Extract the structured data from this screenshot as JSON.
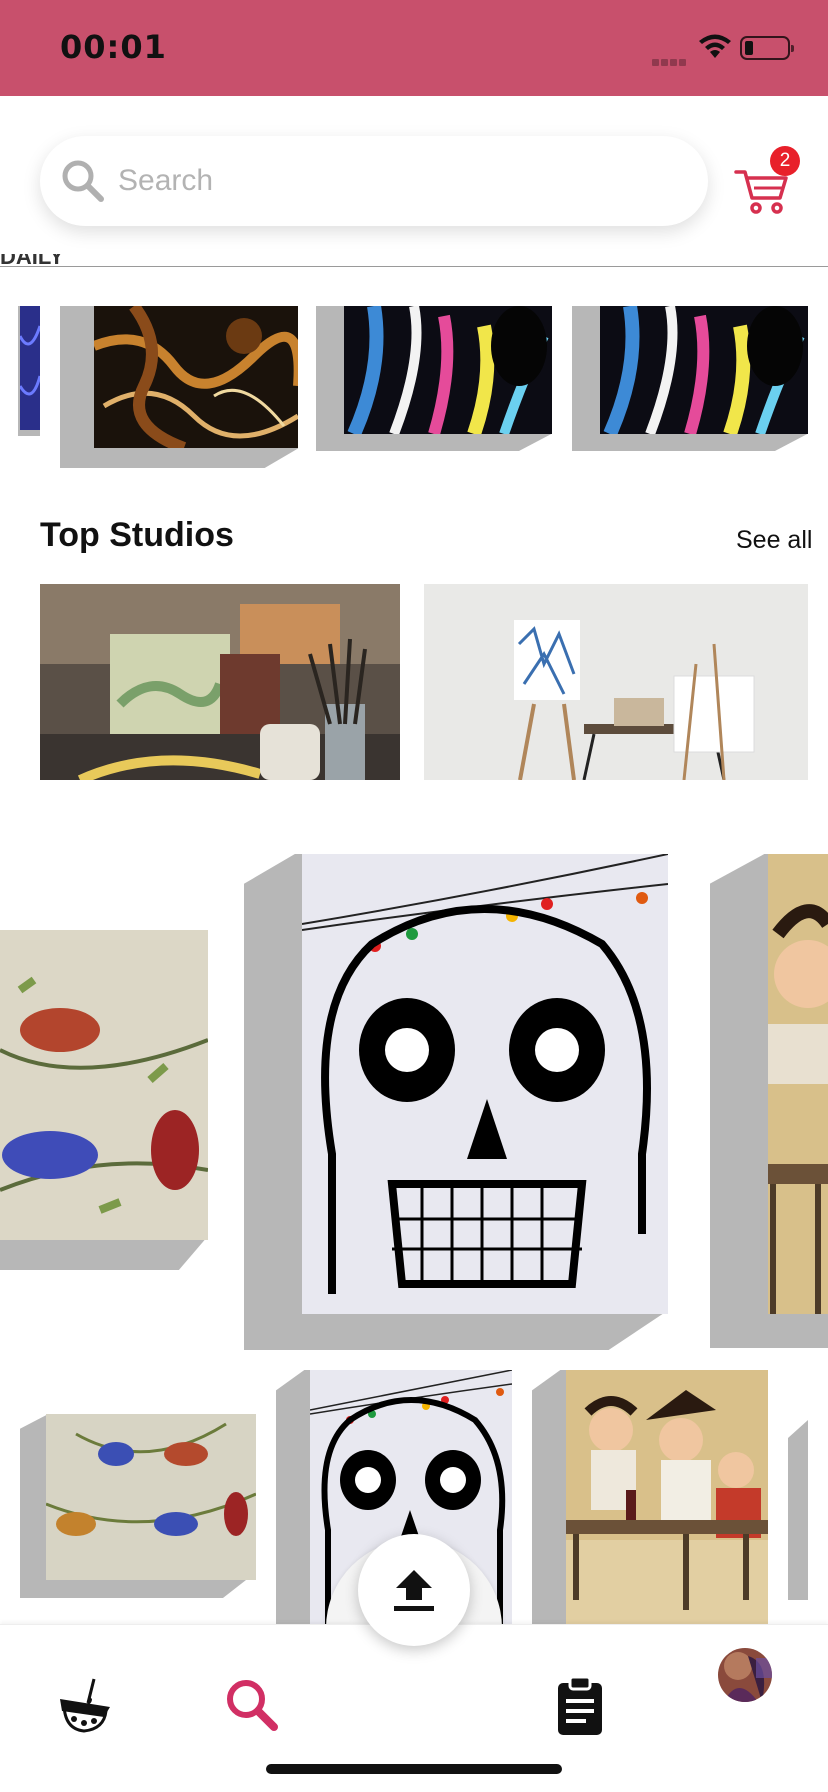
{
  "status_bar": {
    "time": "00:01",
    "battery_level": 0.15
  },
  "search": {
    "placeholder": "Search",
    "value": ""
  },
  "cart": {
    "badge_count": "2"
  },
  "section_heading_partial": "DAILY",
  "top_studios": {
    "title": "Top Studios",
    "see_all_label": "See all"
  },
  "colors": {
    "status_bar_bg": "#c8506c",
    "accent": "#d12f64",
    "badge": "#e8202a",
    "frame_side": "#b7b7b7"
  },
  "tab_bar": {
    "items": [
      "palette-icon",
      "search-icon",
      "upload-icon",
      "clipboard-icon",
      "avatar"
    ],
    "active": "search-icon"
  }
}
